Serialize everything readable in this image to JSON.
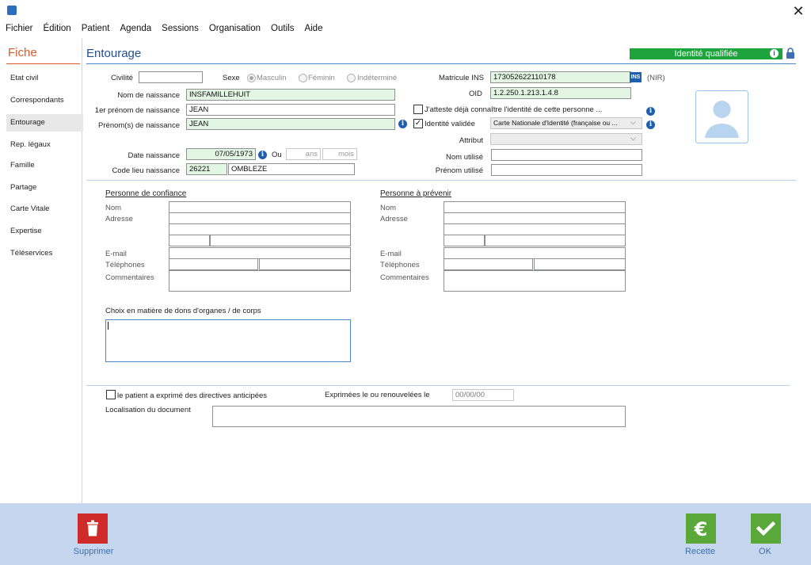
{
  "menu": [
    "Fichier",
    "Édition",
    "Patient",
    "Agenda",
    "Sessions",
    "Organisation",
    "Outils",
    "Aide"
  ],
  "window": {
    "close_glyph": "✕"
  },
  "nav": {
    "title": "Fiche",
    "items": [
      "Etat civil",
      "Correspondants",
      "Entourage",
      "Rep. légaux",
      "Famille",
      "Partage",
      "Carte Vitale",
      "Expertise",
      "Téléservices"
    ],
    "active": "Entourage"
  },
  "header": {
    "section_title": "Entourage",
    "identity_badge": "Identité qualifiée",
    "colors": {
      "badge": "#1ea43c",
      "accent": "#1f4f8f",
      "nav_title": "#e05a2a"
    }
  },
  "form": {
    "civilite_label": "Civilité",
    "civilite_value": "",
    "sexe_label": "Sexe",
    "sexe_options": [
      "Masculin",
      "Féminin",
      "Indéterminé"
    ],
    "sexe_selected": "Masculin",
    "nom_naissance_label": "Nom de naissance",
    "nom_naissance_value": "INSFAMILLEHUIT",
    "premier_prenom_label": "1er prénom de naissance",
    "premier_prenom_value": "JEAN",
    "prenoms_label": "Prénom(s) de naissance",
    "prenoms_value": "JEAN",
    "date_naissance_label": "Date naissance",
    "date_naissance_value": "07/05/1973",
    "ou_label": "Ou",
    "ans_placeholder": "ans",
    "mois_placeholder": "mois",
    "code_lieu_label": "Code lieu naissance",
    "code_lieu_value": "26221",
    "lieu_value": "OMBLEZE",
    "matricule_label": "Matricule INS",
    "matricule_value": "173052622110178",
    "ins_badge": "INS",
    "nir_label": "(NIR)",
    "oid_label": "OID",
    "oid_value": "1.2.250.1.213.1.4.8",
    "atteste_label": "J'atteste déjà connaître l'identité de cette personne ...",
    "identite_validee_label": "Identité validée",
    "piece_identite_value": "Carte Nationale d'Identité (française ou ...",
    "attribut_label": "Attribut",
    "attribut_value": "",
    "nom_utilise_label": "Nom utilisé",
    "prenom_utilise_label": "Prénom utilisé"
  },
  "confiance": {
    "title": "Personne de confiance",
    "nom": "Nom",
    "adresse": "Adresse",
    "email": "E-mail",
    "telephones": "Téléphones",
    "commentaires": "Commentaires"
  },
  "prevenir": {
    "title": "Personne à prévenir",
    "nom": "Nom",
    "adresse": "Adresse",
    "email": "E-mail",
    "telephones": "Téléphones",
    "commentaires": "Commentaires"
  },
  "dons": {
    "label": "Choix en matière de dons d'organes / de corps"
  },
  "directives": {
    "checkbox_label": "le patient a exprimé des directives anticipées",
    "date_label": "Exprimées le ou renouvelées le",
    "date_placeholder": "00/00/00",
    "localisation_label": "Localisation du document"
  },
  "footer": {
    "supprimer": "Supprimer",
    "recette": "Recette",
    "ok": "OK",
    "colors": {
      "delete": "#cf2b2b",
      "confirm": "#5aa83a"
    }
  }
}
